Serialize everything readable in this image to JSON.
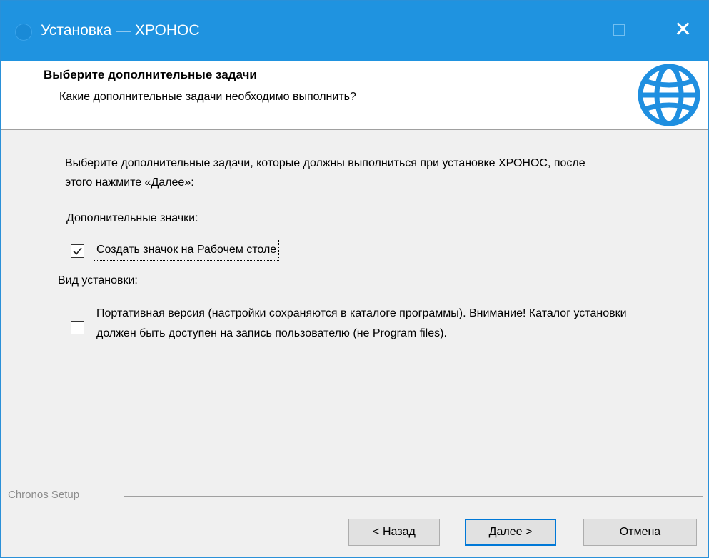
{
  "window": {
    "title": "Установка — ХРОНОС",
    "close_glyph": "✕"
  },
  "header": {
    "heading": "Выберите дополнительные задачи",
    "subheading": "Какие дополнительные задачи необходимо выполнить?"
  },
  "content": {
    "intro": "Выберите дополнительные задачи, которые должны выполниться при установке ХРОНОС, после этого нажмите «Далее»:",
    "groups": [
      {
        "label": "Дополнительные значки:",
        "option": {
          "label": "Создать значок на Рабочем столе",
          "checked": true
        }
      },
      {
        "label": "Вид установки:",
        "option": {
          "label": "Портативная версия (настройки сохраняются в каталоге программы). Внимание! Каталог установки должен быть доступен на запись пользователю (не Program files).",
          "checked": false
        }
      }
    ]
  },
  "footer": {
    "brand": "Chronos Setup",
    "back_label": "< Назад",
    "next_label": "Далее >",
    "cancel_label": "Отмена"
  },
  "colors": {
    "titlebar": "#1f93e0",
    "globe": "#1f8fe0",
    "focus_border": "#0078d7"
  }
}
